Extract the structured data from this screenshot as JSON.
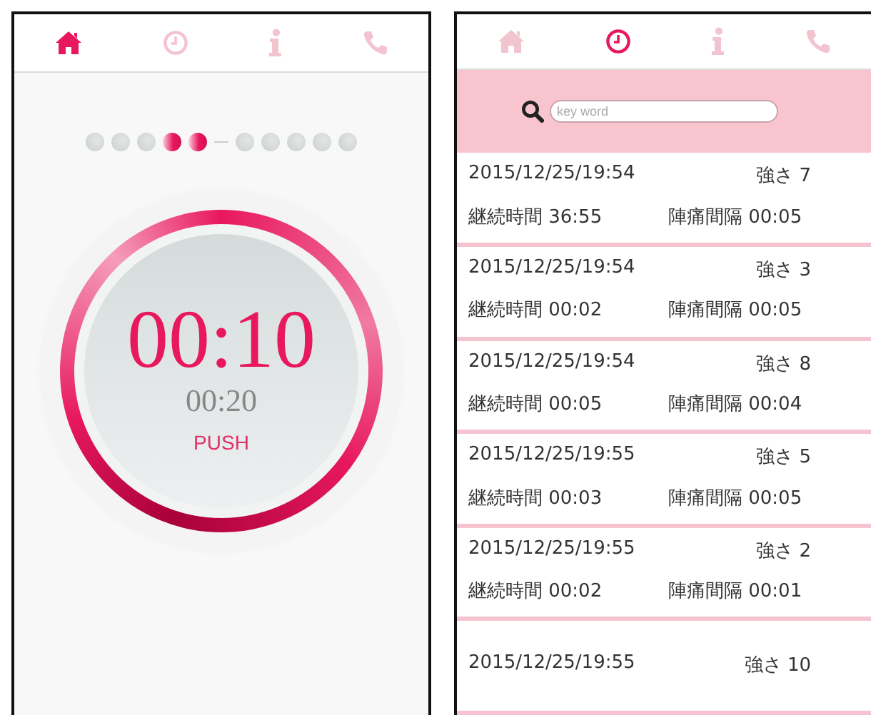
{
  "timer_screen": {
    "tabs": [
      {
        "kind": "home",
        "selected": true
      },
      {
        "kind": "clock",
        "selected": false
      },
      {
        "kind": "info",
        "selected": false
      },
      {
        "kind": "phone",
        "selected": false
      }
    ],
    "progress_dots": [
      {
        "kind": "dot",
        "on": false
      },
      {
        "kind": "dot",
        "on": false
      },
      {
        "kind": "dot",
        "on": false
      },
      {
        "kind": "dot",
        "on": true
      },
      {
        "kind": "dot",
        "on": true
      },
      {
        "kind": "dash"
      },
      {
        "kind": "dot",
        "on": false
      },
      {
        "kind": "dot",
        "on": false
      },
      {
        "kind": "dot",
        "on": false
      },
      {
        "kind": "dot",
        "on": false
      },
      {
        "kind": "dot",
        "on": false
      }
    ],
    "timer": {
      "elapsed": "00:10",
      "interval": "00:20",
      "button": "PUSH"
    }
  },
  "history_screen": {
    "tabs": [
      {
        "kind": "home",
        "selected": false
      },
      {
        "kind": "clock",
        "selected": true
      },
      {
        "kind": "info",
        "selected": false
      },
      {
        "kind": "phone",
        "selected": false
      }
    ],
    "search": {
      "placeholder": "key word"
    },
    "records": [
      {
        "datetime": "2015/12/25/19:54",
        "strength": "強さ 7",
        "duration": "継続時間 36:55",
        "interval": "陣痛間隔 00:05"
      },
      {
        "datetime": "2015/12/25/19:54",
        "strength": "強さ 3",
        "duration": "継続時間 00:02",
        "interval": "陣痛間隔 00:05"
      },
      {
        "datetime": "2015/12/25/19:54",
        "strength": "強さ 8",
        "duration": "継続時間 00:05",
        "interval": "陣痛間隔 00:04"
      },
      {
        "datetime": "2015/12/25/19:55",
        "strength": "強さ 5",
        "duration": "継続時間 00:03",
        "interval": "陣痛間隔 00:05"
      },
      {
        "datetime": "2015/12/25/19:55",
        "strength": "強さ 2",
        "duration": "継続時間 00:02",
        "interval": "陣痛間隔 00:01"
      },
      {
        "datetime": "2015/12/25/19:55",
        "strength": "強さ 10"
      }
    ]
  }
}
